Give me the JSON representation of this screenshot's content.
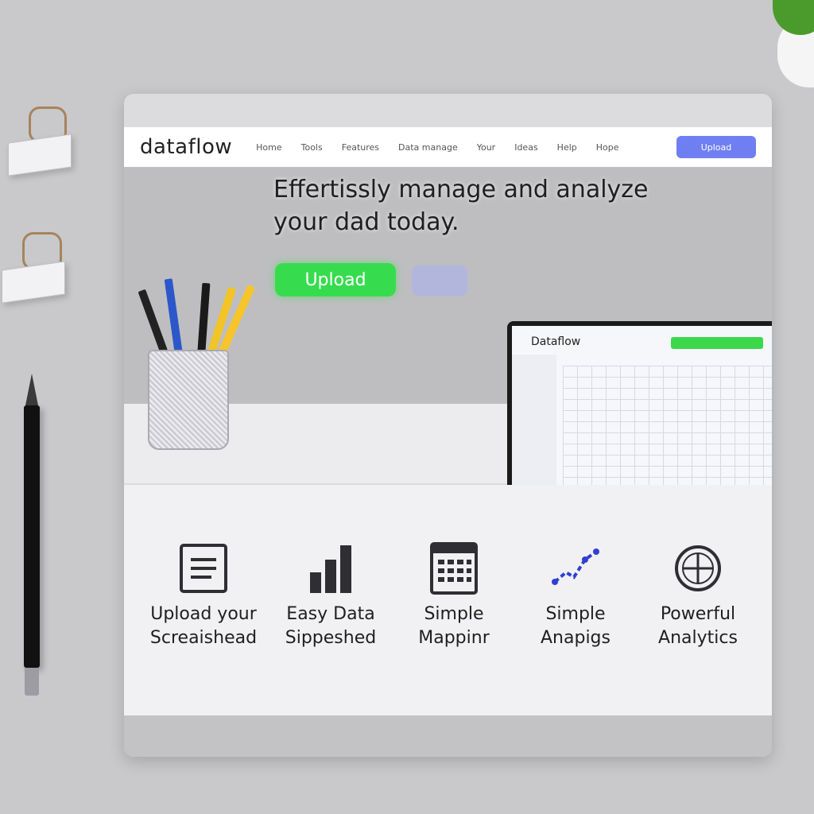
{
  "brand": {
    "logo": "dataflow"
  },
  "nav": {
    "links": [
      "Home",
      "Tools",
      "Features",
      "Data manage",
      "Your",
      "Ideas",
      "Help",
      "Hope"
    ],
    "cta_label": "Upload"
  },
  "hero": {
    "title_line1": "Effertissly manage and analyze",
    "title_line2": "your dad today.",
    "primary_button": "Upload"
  },
  "laptop_screen": {
    "logo": "Dataflow"
  },
  "features": [
    {
      "icon": "document-icon",
      "label_line1": "Upload your",
      "label_line2": "Screaishead"
    },
    {
      "icon": "bar-chart-icon",
      "label_line1": "Easy Data",
      "label_line2": "Sippeshed"
    },
    {
      "icon": "spreadsheet-icon",
      "label_line1": "Simple",
      "label_line2": "Mappinr"
    },
    {
      "icon": "trend-icon",
      "label_line1": "Simple",
      "label_line2": "Anapigs"
    },
    {
      "icon": "target-icon",
      "label_line1": "Powerful",
      "label_line2": "Analytics"
    }
  ],
  "colors": {
    "accent_green": "#37dc4e",
    "accent_blue": "#6f7ff2",
    "background": "#c9c9cc"
  }
}
